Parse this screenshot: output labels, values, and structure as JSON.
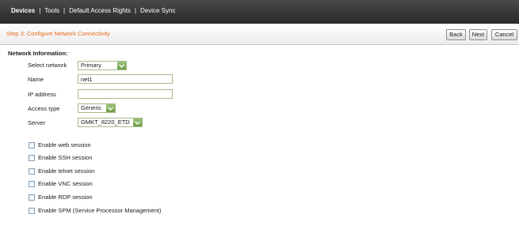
{
  "nav": {
    "items": [
      {
        "label": "Devices"
      },
      {
        "label": "Tools"
      },
      {
        "label": "Default Access Rights"
      },
      {
        "label": "Device Sync"
      }
    ],
    "separator": "|"
  },
  "wizard": {
    "step_title": "Step 3: Configure Network Connectivity",
    "back_label": "Back",
    "next_label": "Next",
    "cancel_label": "Cancel"
  },
  "form": {
    "section_title": "Network Information:",
    "select_network": {
      "label": "Select network",
      "value": "Primary"
    },
    "name": {
      "label": "Name",
      "value": "net1"
    },
    "ip_address": {
      "label": "IP address",
      "value": ""
    },
    "access_type": {
      "label": "Access type",
      "value": "Generic"
    },
    "server": {
      "label": "Server",
      "value": "GMKT_8220_ETD"
    },
    "options": [
      {
        "label": "Enable web session",
        "checked": false
      },
      {
        "label": "Enable SSH session",
        "checked": false
      },
      {
        "label": "Enable telnet session",
        "checked": false
      },
      {
        "label": "Enable VNC session",
        "checked": false
      },
      {
        "label": "Enable RDP session",
        "checked": false
      },
      {
        "label": "Enable SPM (Service Processor Management)",
        "checked": false
      }
    ]
  },
  "colors": {
    "nav_bg": "#3a3a3a",
    "step_title": "#e86a1c",
    "select_arrow": "#7fac57",
    "input_border": "#a7b98a"
  }
}
